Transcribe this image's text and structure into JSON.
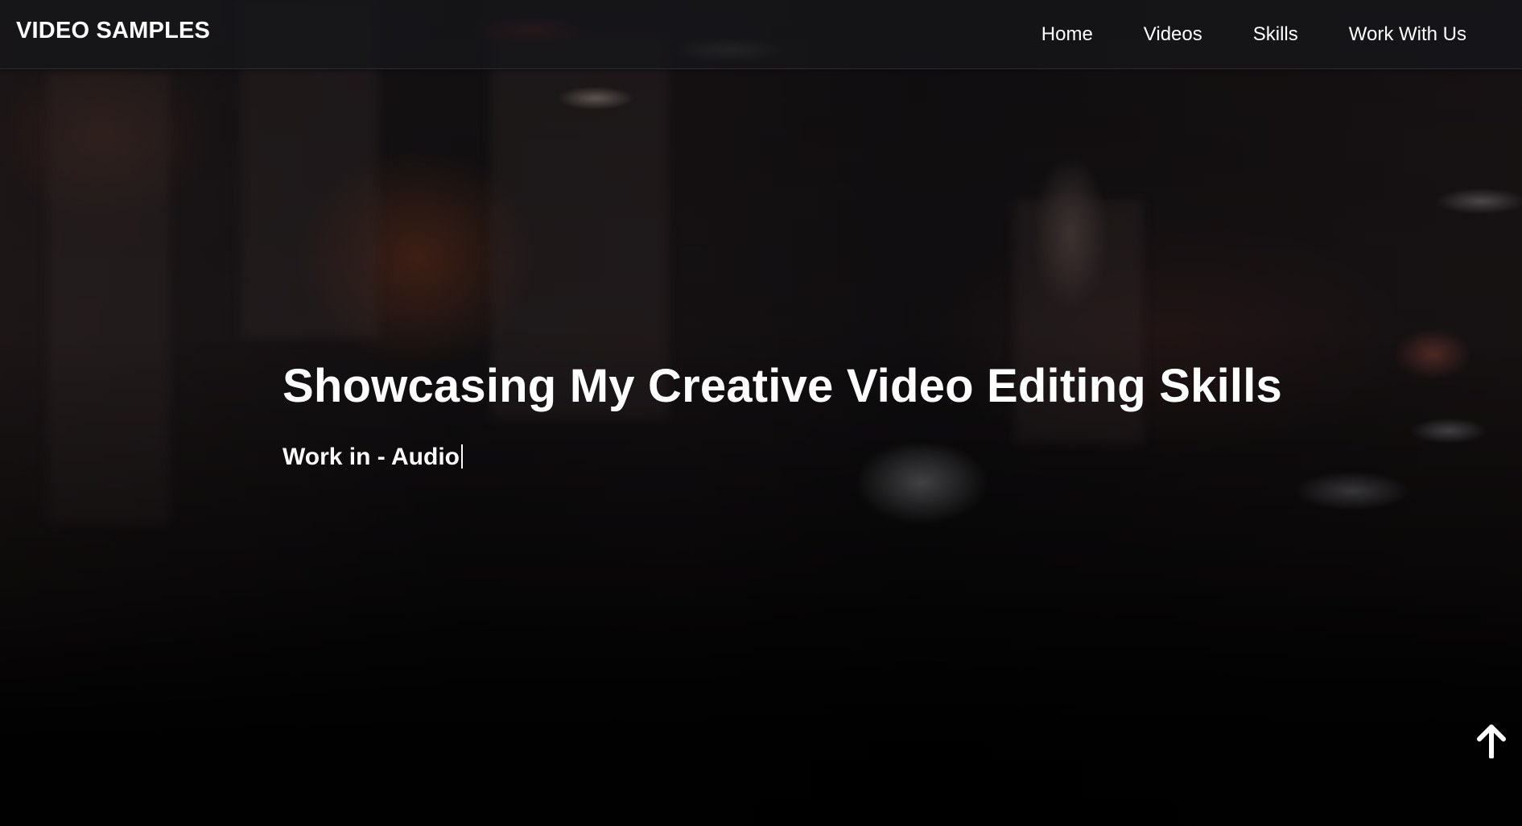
{
  "brand": {
    "logo_text": "VIDEO SAMPLES"
  },
  "nav": {
    "items": [
      {
        "label": "Home"
      },
      {
        "label": "Videos"
      },
      {
        "label": "Skills"
      },
      {
        "label": "Work With Us"
      }
    ]
  },
  "hero": {
    "title": "Showcasing My Creative Video Editing Skills",
    "subtitle": "Work in - Audio",
    "subtitle_cursor": "|"
  },
  "scroll_top": {
    "icon": "arrow-up-icon"
  },
  "colors": {
    "text": "#ffffff",
    "navbar_bg": "#16161a",
    "page_bg": "#000000"
  }
}
